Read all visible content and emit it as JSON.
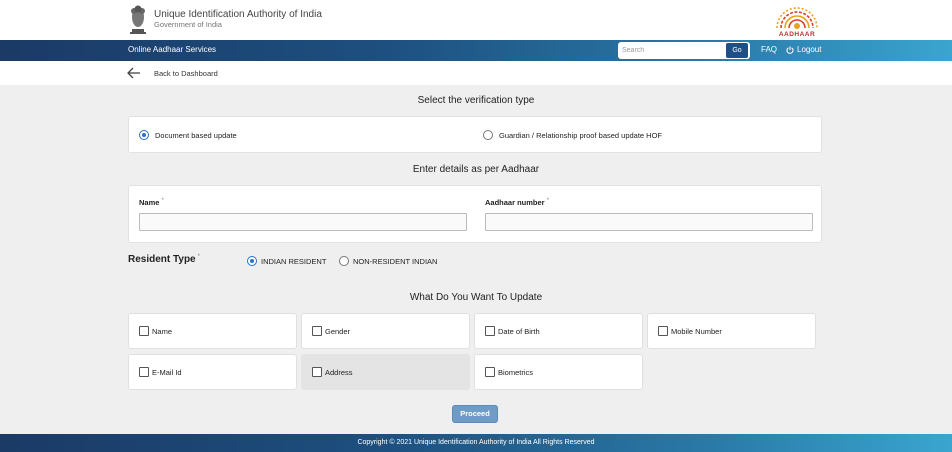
{
  "header": {
    "org_name": "Unique Identification Authority of India",
    "org_sub": "Government of India",
    "logo_text": "AADHAAR"
  },
  "navbar": {
    "title": "Online Aadhaar Services",
    "search_placeholder": "Search",
    "go_label": "Go",
    "faq_label": "FAQ",
    "logout_label": "Logout"
  },
  "back": {
    "label": "Back to Dashboard"
  },
  "verification": {
    "title": "Select the verification type",
    "options": [
      {
        "label": "Document based update",
        "selected": true
      },
      {
        "label": "Guardian / Relationship proof based update HOF",
        "selected": false
      }
    ]
  },
  "details": {
    "title": "Enter details as per Aadhaar",
    "name_label": "Name",
    "aadhaar_label": "Aadhaar number",
    "required_mark": "*",
    "name_value": "",
    "aadhaar_value": ""
  },
  "resident": {
    "label": "Resident Type",
    "options": [
      {
        "label": "INDIAN RESIDENT",
        "selected": true
      },
      {
        "label": "NON-RESIDENT INDIAN",
        "selected": false
      }
    ]
  },
  "update": {
    "title": "What Do You Want To Update",
    "items": [
      {
        "label": "Name",
        "checked": false
      },
      {
        "label": "Gender",
        "checked": false
      },
      {
        "label": "Date of Birth",
        "checked": false
      },
      {
        "label": "Mobile Number",
        "checked": false
      },
      {
        "label": "E-Mail Id",
        "checked": false
      },
      {
        "label": "Address",
        "checked": false
      },
      {
        "label": "Biometrics",
        "checked": false
      }
    ]
  },
  "proceed_label": "Proceed",
  "footer": {
    "text": "Copyright © 2021 Unique Identification Authority of India All Rights Reserved"
  },
  "colors": {
    "navbar_start": "#1b3a66",
    "navbar_end": "#3aa5d0",
    "accent": "#2b72c9",
    "proceed": "#6f9cc6",
    "logo_red": "#b5312b"
  }
}
